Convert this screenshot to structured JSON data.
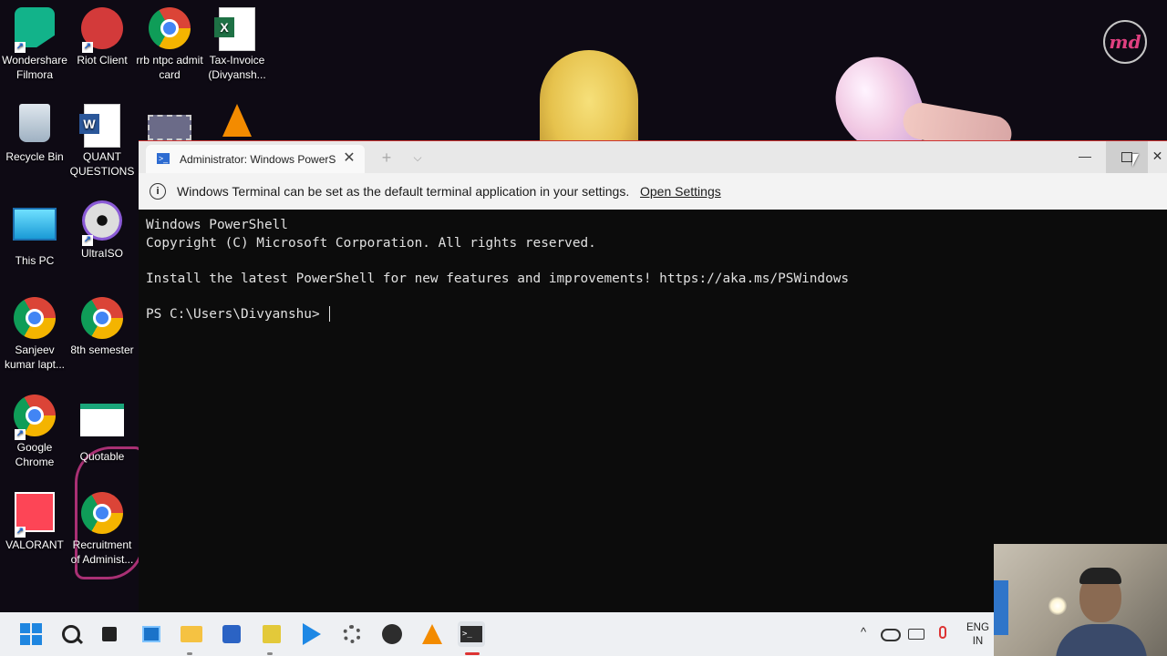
{
  "desktop": {
    "icons": [
      {
        "label": "Wondershare Filmora",
        "icon": "filmora-icon"
      },
      {
        "label": "Riot Client",
        "icon": "riot-client-icon"
      },
      {
        "label": "rrb ntpc admit card",
        "icon": "chrome-icon"
      },
      {
        "label": "Tax-Invoice (Divyansh...",
        "icon": "excel-icon"
      },
      {
        "label": "Recycle Bin",
        "icon": "recycle-bin-icon"
      },
      {
        "label": "QUANT QUESTIONS",
        "icon": "word-icon"
      },
      {
        "label": "This PC",
        "icon": "this-pc-icon"
      },
      {
        "label": "UltraISO",
        "icon": "ultraiso-icon"
      },
      {
        "label": "Sanjeev kumar lapt...",
        "icon": "chrome-icon"
      },
      {
        "label": "8th semester",
        "icon": "chrome-icon"
      },
      {
        "label": "Google Chrome",
        "icon": "chrome-icon"
      },
      {
        "label": "Quotable",
        "icon": "powerpoint-icon"
      },
      {
        "label": "VALORANT",
        "icon": "valorant-icon"
      },
      {
        "label": "Recruitment of Administ...",
        "icon": "chrome-icon"
      }
    ]
  },
  "terminal": {
    "tab_title": "Administrator: Windows PowerS",
    "tab_close": "✕",
    "new_tab": "+",
    "dropdown": "⌵",
    "minimize": "—",
    "close": "✕",
    "info_icon": "i",
    "info_message": "Windows Terminal can be set as the default terminal application in your settings.",
    "info_link": "Open Settings",
    "lines": [
      "Windows PowerShell",
      "Copyright (C) Microsoft Corporation. All rights reserved.",
      "",
      "Install the latest PowerShell for new features and improvements! https://aka.ms/PSWindows",
      ""
    ],
    "prompt": "PS C:\\Users\\Divyanshu> "
  },
  "taskbar": {
    "apps": [
      "start",
      "search",
      "task-view",
      "widgets",
      "file-explorer",
      "microsoft-store",
      "sticky-notes",
      "vs-code",
      "settings",
      "obs",
      "vlc",
      "windows-terminal"
    ],
    "tray": {
      "chevron": "^",
      "lang_line1": "ENG",
      "lang_line2": "IN"
    }
  },
  "colors": {
    "terminal_bg": "#0c0c0c",
    "titlebar_bg": "#e8e8e8",
    "infobar_bg": "#f3f3f3",
    "taskbar_bg": "#eef0f3",
    "accent": "#1f86e0"
  }
}
